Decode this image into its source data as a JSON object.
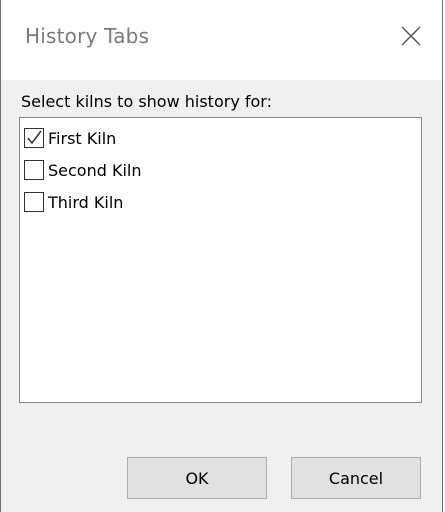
{
  "window": {
    "title": "History Tabs"
  },
  "icons": {
    "close": "close-icon",
    "check": "checkmark-icon"
  },
  "dialog": {
    "prompt": "Select kilns to show history for:",
    "kilns": [
      {
        "label": "First Kiln",
        "checked": true
      },
      {
        "label": "Second Kiln",
        "checked": false
      },
      {
        "label": "Third Kiln",
        "checked": false
      }
    ],
    "ok_label": "OK",
    "cancel_label": "Cancel"
  },
  "colors": {
    "dialog_background": "#f0f0f0",
    "title_text": "#7a7a7a",
    "button_face": "#e1e1e1",
    "button_border": "#adadad"
  }
}
